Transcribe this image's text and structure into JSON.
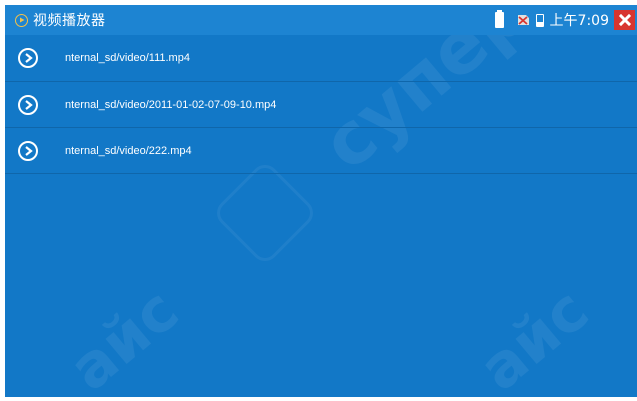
{
  "status_bar": {
    "title": "视频播放器",
    "time": "上午7:09",
    "icons": [
      "play-circle-icon",
      "battery-icon",
      "sd-card-icon",
      "storage-icon",
      "close-icon"
    ]
  },
  "files": [
    {
      "name": "nternal_sd/video/111.mp4"
    },
    {
      "name": "nternal_sd/video/2011-01-02-07-09-10.mp4"
    },
    {
      "name": "nternal_sd/video/222.mp4"
    }
  ],
  "colors": {
    "background": "#1278c7",
    "status_bar": "#1d84d2",
    "close": "#d8352f",
    "accent": "#f2c14a"
  }
}
